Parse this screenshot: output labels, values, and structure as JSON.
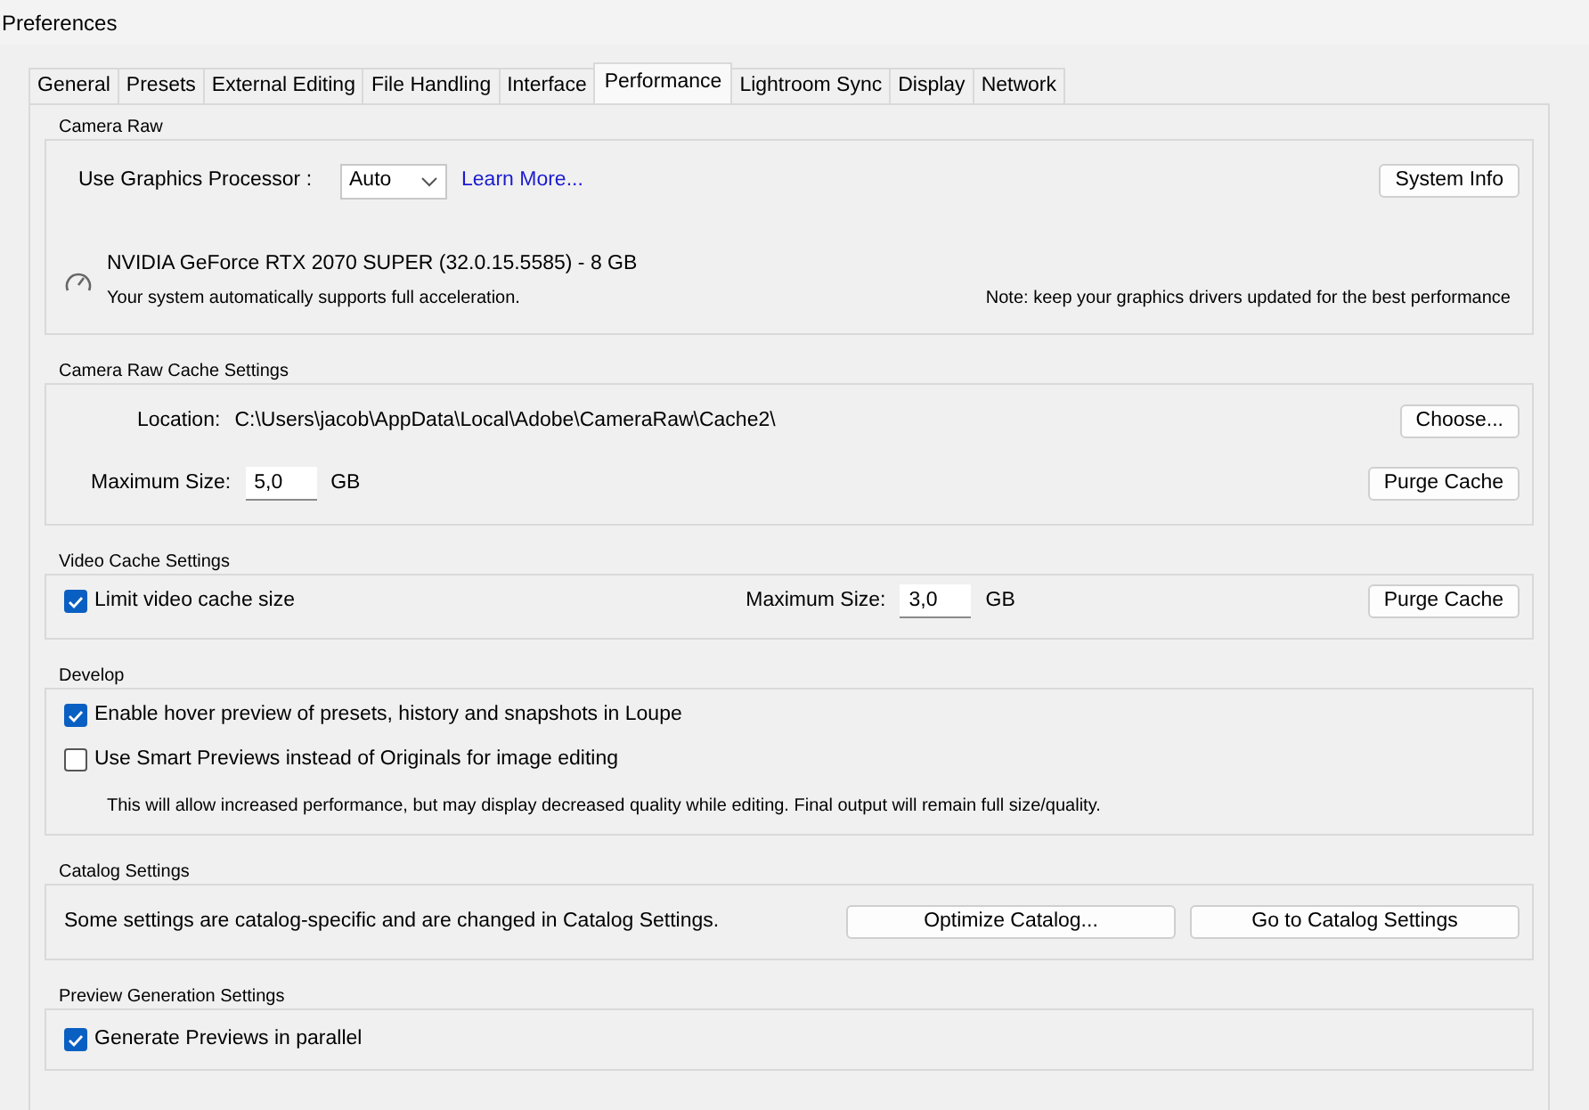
{
  "window": {
    "title": "Preferences"
  },
  "tabs": [
    {
      "label": "General",
      "selected": false
    },
    {
      "label": "Presets",
      "selected": false
    },
    {
      "label": "External Editing",
      "selected": false
    },
    {
      "label": "File Handling",
      "selected": false
    },
    {
      "label": "Interface",
      "selected": false
    },
    {
      "label": "Performance",
      "selected": true
    },
    {
      "label": "Lightroom Sync",
      "selected": false
    },
    {
      "label": "Display",
      "selected": false
    },
    {
      "label": "Network",
      "selected": false
    }
  ],
  "sections": [
    {
      "title": "Camera Raw",
      "rows": [
        {
          "kind": "controls",
          "left": [
            {
              "kind": "label",
              "text": "Use Graphics Processor :"
            },
            {
              "kind": "select",
              "value": "Auto"
            },
            {
              "kind": "link",
              "text": "Learn More..."
            }
          ],
          "right": [
            {
              "kind": "button",
              "text": "System Info"
            }
          ]
        },
        {
          "kind": "gpu",
          "name": "NVIDIA GeForce RTX 2070 SUPER (32.0.15.5585) - 8 GB",
          "status": "Your system automatically supports full acceleration.",
          "note": "Note: keep your graphics drivers updated for the best performance"
        }
      ]
    },
    {
      "title": "Camera Raw Cache Settings",
      "rows": [
        {
          "kind": "controls",
          "left": [
            {
              "kind": "label",
              "text": "Location:"
            },
            {
              "kind": "text",
              "text": "C:\\Users\\jacob\\AppData\\Local\\Adobe\\CameraRaw\\Cache2\\"
            }
          ],
          "right": [
            {
              "kind": "button",
              "text": "Choose..."
            }
          ]
        },
        {
          "kind": "controls",
          "left": [
            {
              "kind": "label",
              "text": "Maximum Size:"
            },
            {
              "kind": "field",
              "value": "5,0"
            },
            {
              "kind": "label",
              "text": "GB"
            }
          ],
          "right": [
            {
              "kind": "button",
              "text": "Purge Cache"
            }
          ]
        }
      ]
    },
    {
      "title": "Video Cache Settings",
      "rows": [
        {
          "kind": "controls",
          "left": [
            {
              "kind": "checkbox",
              "text": "Limit video cache size",
              "checked": true
            }
          ],
          "right": [
            {
              "kind": "label",
              "text": "Maximum Size:"
            },
            {
              "kind": "field",
              "value": "3,0"
            },
            {
              "kind": "label",
              "text": "GB"
            },
            {
              "kind": "button",
              "text": "Purge Cache"
            }
          ]
        }
      ]
    },
    {
      "title": "Develop",
      "rows": [
        {
          "kind": "controls",
          "left": [
            {
              "kind": "checkbox",
              "text": "Enable hover preview of presets, history and snapshots in Loupe",
              "checked": true
            }
          ],
          "right": []
        },
        {
          "kind": "controls",
          "left": [
            {
              "kind": "checkbox",
              "text": "Use Smart Previews instead of Originals for image editing",
              "checked": false
            }
          ],
          "right": []
        },
        {
          "kind": "note",
          "text": "This will allow increased performance, but may display decreased quality while editing. Final output will remain full size/quality."
        }
      ]
    },
    {
      "title": "Catalog Settings",
      "rows": [
        {
          "kind": "controls",
          "left": [
            {
              "kind": "text",
              "text": "Some settings are catalog-specific and are changed in Catalog Settings."
            }
          ],
          "right": [
            {
              "kind": "widebutton",
              "text": "Optimize Catalog..."
            },
            {
              "kind": "widebutton",
              "text": "Go to Catalog Settings"
            }
          ]
        }
      ]
    },
    {
      "title": "Preview Generation Settings",
      "rows": [
        {
          "kind": "controls",
          "left": [
            {
              "kind": "checkbox",
              "text": "Generate Previews in parallel",
              "checked": true
            }
          ],
          "right": []
        }
      ]
    }
  ]
}
